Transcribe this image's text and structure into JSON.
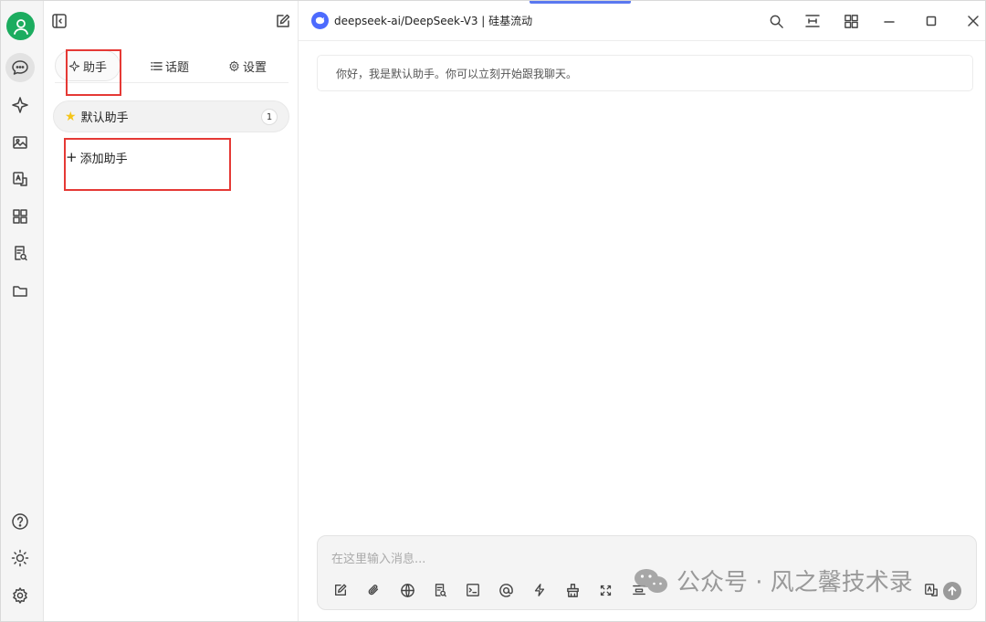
{
  "colors": {
    "accent": "#1cac5f",
    "model_logo": "#4d6bfe",
    "highlight_box": "#e53935",
    "star": "#f5c518"
  },
  "rail": {
    "icons": [
      "user-avatar-icon",
      "chat-icon",
      "sparkle-icon",
      "image-icon",
      "translate-icon",
      "apps-icon",
      "search-doc-icon",
      "folder-icon",
      "help-icon",
      "theme-icon",
      "settings-icon"
    ]
  },
  "side": {
    "tabs": [
      {
        "label": "助手",
        "icon": "sparkle-icon"
      },
      {
        "label": "话题",
        "icon": "list-icon"
      },
      {
        "label": "设置",
        "icon": "gear-icon"
      }
    ],
    "assistant": {
      "name": "默认助手",
      "count": "1"
    },
    "add_label": "添加助手"
  },
  "topbar": {
    "model": "deepseek-ai/DeepSeek-V3 | 硅基流动"
  },
  "welcome_text": "你好，我是默认助手。你可以立刻开始跟我聊天。",
  "composer": {
    "placeholder": "在这里输入消息..."
  },
  "watermark": "公众号 · 风之馨技术录"
}
